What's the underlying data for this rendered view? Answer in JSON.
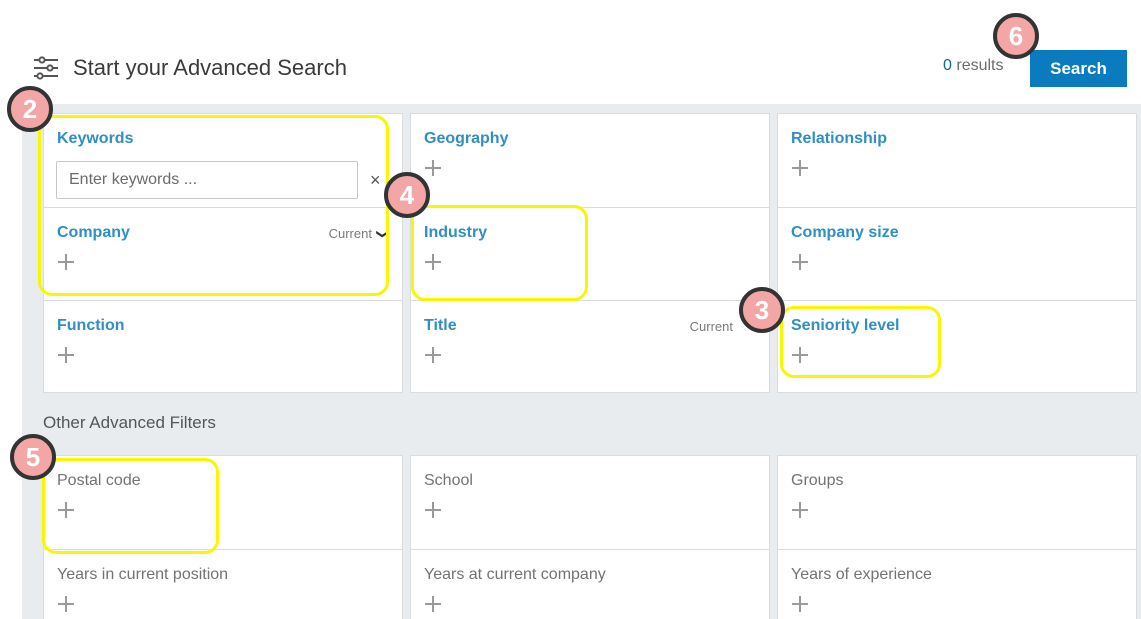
{
  "header": {
    "title": "Start your Advanced Search",
    "results_count": "0",
    "results_label": "results",
    "search_button": "Search"
  },
  "main_filters": {
    "keywords": {
      "label": "Keywords",
      "placeholder": "Enter keywords ...",
      "clear_icon": "×"
    },
    "company": {
      "label": "Company",
      "modifier": "Current",
      "chevron": "❯"
    },
    "function": {
      "label": "Function"
    },
    "geography": {
      "label": "Geography"
    },
    "industry": {
      "label": "Industry"
    },
    "title": {
      "label": "Title",
      "modifier": "Current"
    },
    "relationship": {
      "label": "Relationship"
    },
    "company_size": {
      "label": "Company size"
    },
    "seniority_level": {
      "label": "Seniority level"
    }
  },
  "other_filters": {
    "section_title": "Other Advanced Filters",
    "postal_code": "Postal code",
    "school": "School",
    "groups": "Groups",
    "years_in_position": "Years in current position",
    "years_at_company": "Years at current company",
    "years_experience": "Years of experience"
  },
  "annotations": [
    "2",
    "3",
    "4",
    "5",
    "6"
  ],
  "colors": {
    "highlight": "#f7f700",
    "badge_fill": "#f2a6a6",
    "link_blue": "#2f8fc4",
    "button_blue": "#0a7bbf"
  },
  "icons": [
    "sliders-filter-icon",
    "plus-icon",
    "close-icon",
    "chevron-down-icon"
  ]
}
